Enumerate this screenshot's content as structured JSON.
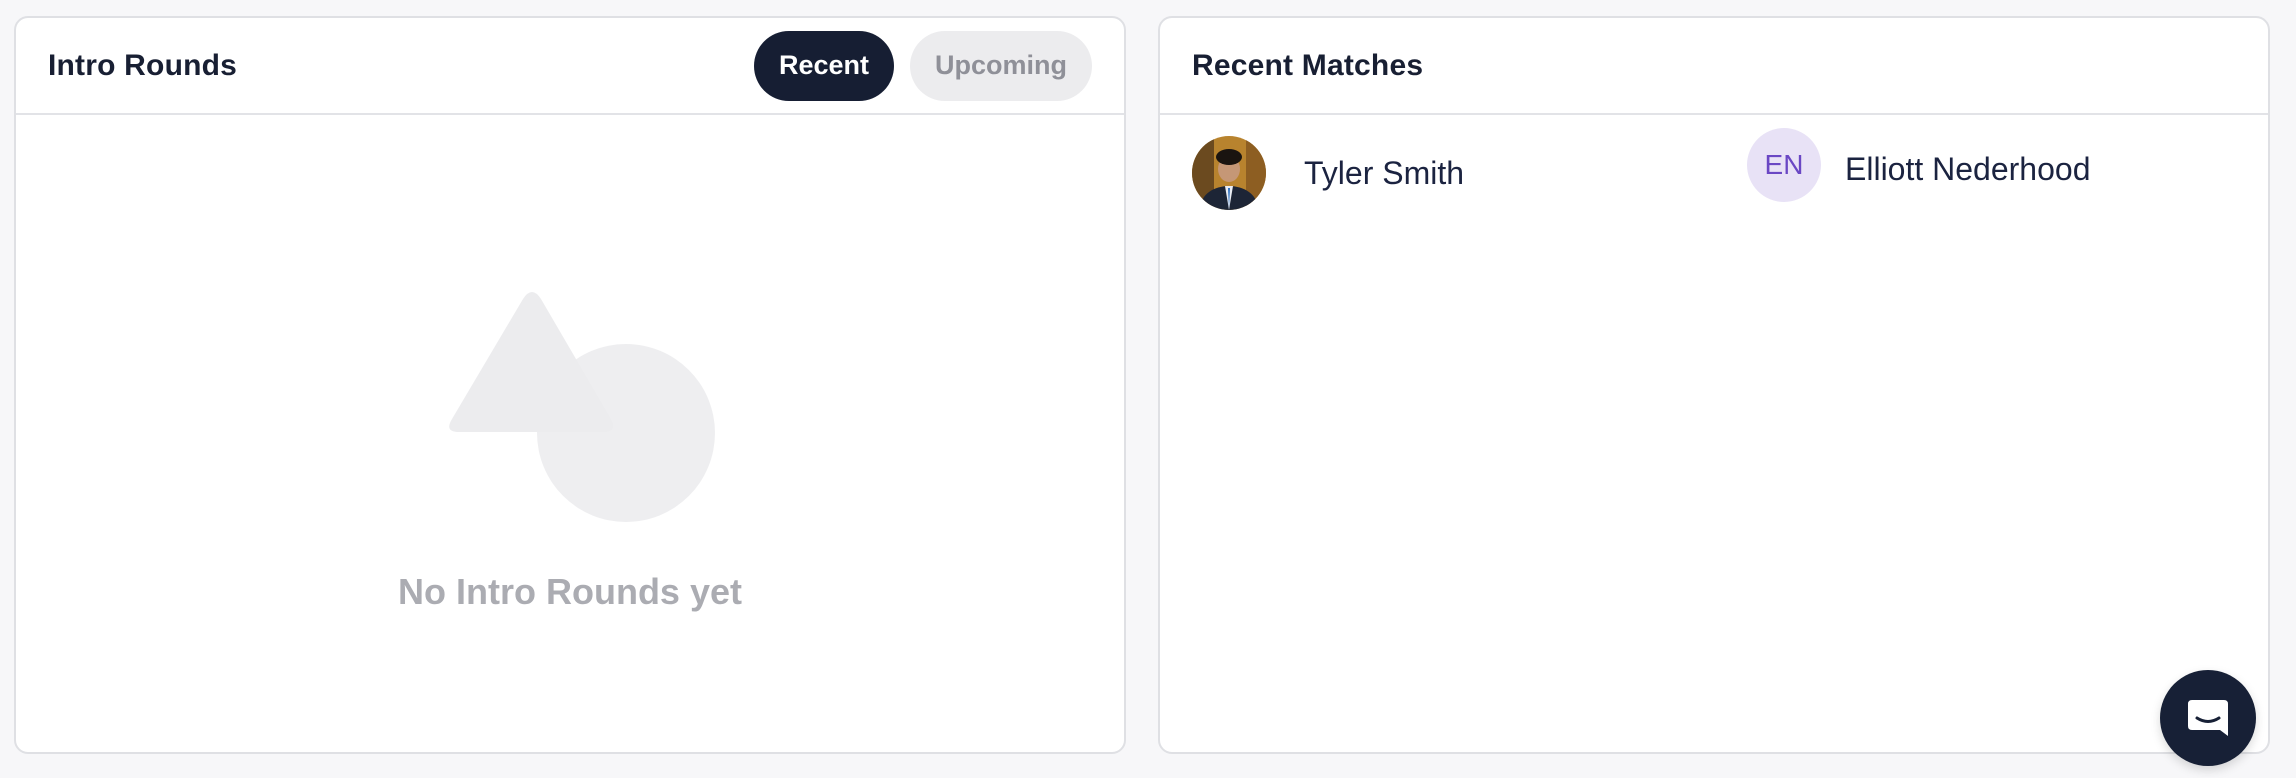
{
  "intro_rounds": {
    "title": "Intro Rounds",
    "tabs": [
      {
        "label": "Recent",
        "active": true
      },
      {
        "label": "Upcoming",
        "active": false
      }
    ],
    "empty_message": "No Intro Rounds yet"
  },
  "recent_matches": {
    "title": "Recent Matches",
    "matches": [
      {
        "person_a": {
          "name": "Tyler Smith",
          "avatar": "photo"
        },
        "person_b": {
          "name": "Elliott Nederhood",
          "initials": "EN"
        }
      }
    ]
  },
  "chat_launcher": {
    "icon": "chat-bubble-icon"
  },
  "colors": {
    "primary_dark": "#161e33",
    "pill_inactive_bg": "#ececee",
    "initials_bg": "#e8e2f6",
    "initials_text": "#6a47c4",
    "empty_text": "#abacb2"
  }
}
